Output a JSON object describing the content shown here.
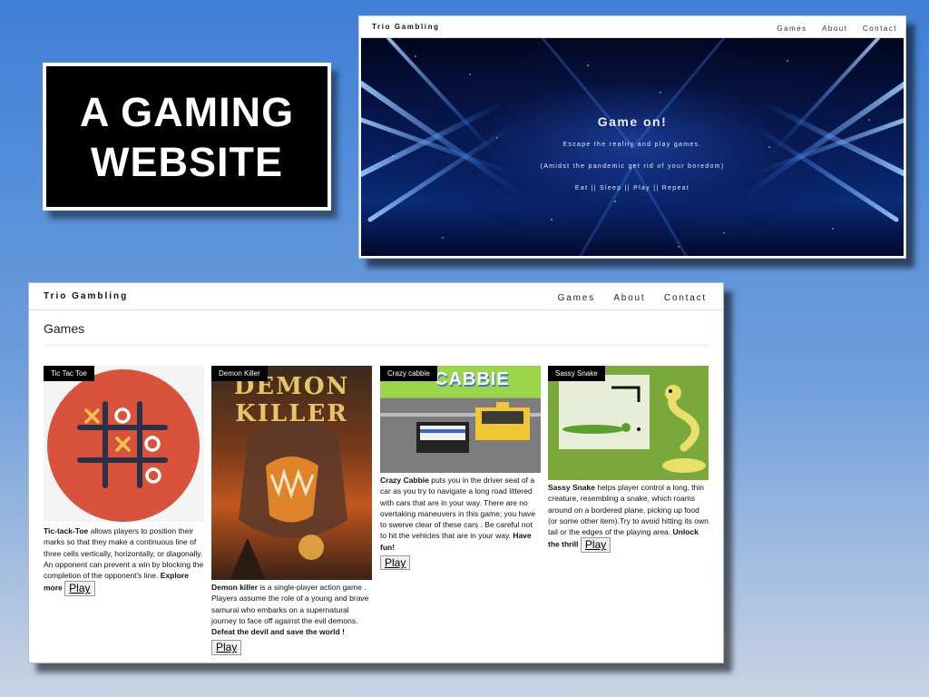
{
  "slide_title": {
    "line1": "A  GAMING",
    "line2": "WEBSITE"
  },
  "top_site": {
    "brand": "Trio Gambling",
    "nav": [
      "Games",
      "About",
      "Contact"
    ],
    "hero": {
      "title": "Game on!",
      "line1": "Escape the reality and play games.",
      "line2": "(Amidst the pandemic get rid of your boredom)",
      "line3": "Eat || Sleep || Play || Repeat"
    }
  },
  "games_site": {
    "brand": "Trio Gambling",
    "nav": [
      "Games",
      "About",
      "Contact"
    ],
    "heading": "Games",
    "cards": [
      {
        "tag": "Tic Tac Toe",
        "name_bold": "Tic-tack-Toe",
        "text": " allows players to position their marks so that they make a continuous line of three cells vertically, horizontally, or diagonally. An opponent can prevent a win by blocking the completion of the opponent's line. ",
        "cta": "Explore more",
        "play": "Play"
      },
      {
        "tag": "Demon Killer",
        "image_text": "DEMON KILLER",
        "name_bold": "Demon killer",
        "text": " is a single-player action game . Players assume the role of a young and brave samurai who embarks on a supernatural journey to face off against the evil demons. ",
        "cta": "Defeat the devil and save the world !",
        "play": "Play"
      },
      {
        "tag": "Crazy cabbie",
        "image_text": "CABBIE",
        "name_bold": "Crazy Cabbie",
        "text": " puts you in the driver seat of a car as you try to navigate a long road littered with cars that are in your way. There are no overtaking maneuvers in this game; you have to swerve clear of these cars . Be careful not to hit the vehicles that are in your way. ",
        "cta": "Have fun!",
        "play": "Play"
      },
      {
        "tag": "Sassy Snake",
        "name_bold": "Sassy Snake",
        "text": " helps player control a long, thin creature, resembling a snake, which roams around on a bordered plane, picking up food (or some other item).Try to avoid hitting its own tail or the edges of the playing area. ",
        "cta": "Unlock the thrill",
        "play": "Play"
      }
    ]
  },
  "colors": {
    "hero_dark": "#03092c",
    "hero_blue": "#2a78f0",
    "tictactoe_red": "#d9533c",
    "snake_green": "#7aa83a"
  }
}
